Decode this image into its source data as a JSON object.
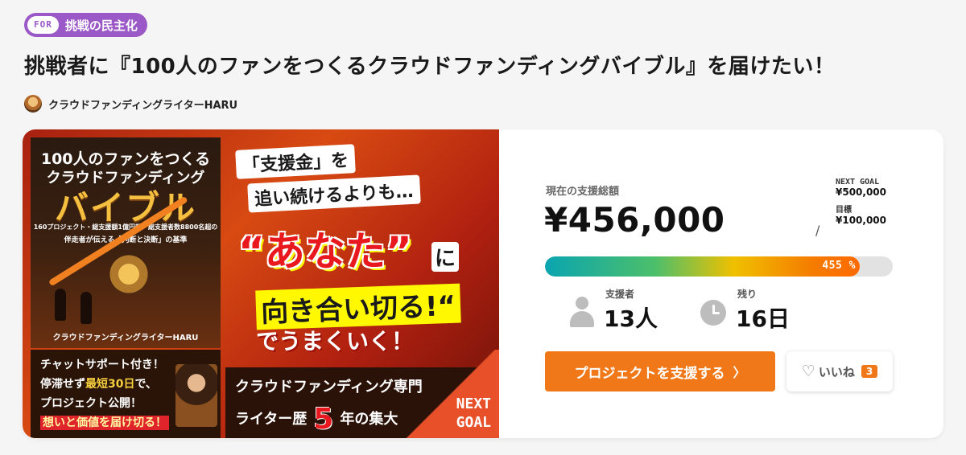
{
  "tag": {
    "prefix": "FOR",
    "label": "挑戦の民主化"
  },
  "title": "挑戦者に『100人のファンをつくるクラウドファンディングバイブル』を届けたい！",
  "author": {
    "name": "クラウドファンディングライターHARU"
  },
  "banner": {
    "book_line1": "100人のファンをつくる",
    "book_line2": "クラウドファンディング",
    "book_big": "バイブル",
    "book_sub1": "160プロジェクト・総支援額1億円超・総支援者数8800名超の",
    "book_sub2": "伴走者が伝える「判断と決断」の基準",
    "book_author": "クラウドファンディングライターHARU",
    "chat1": "チャットサポート付き！",
    "chat2a": "停滞せず",
    "chat2b": "最短30日",
    "chat2c": "で、",
    "chat3": "プロジェクト公開！",
    "chat4": "想いと価値を届け切る！",
    "headline1": "「支援金」を",
    "headline2": "追い続けるよりも…",
    "anata": "“あなた”",
    "ni": "に",
    "mukiai": "向き合い切る!“",
    "umaku": "でうまくいく！",
    "strip1": "クラウドファンディング専門",
    "strip2a": "ライター歴",
    "strip2_num": "5",
    "strip2b": "年の集大",
    "next1": "NEXT",
    "next2": "GOAL"
  },
  "stats": {
    "amount_label": "現在の支援総額",
    "amount": "¥456,000",
    "goal_slash": "/",
    "next_goal_caption": "NEXT GOAL",
    "next_goal_value": "¥500,000",
    "goal_caption": "目標",
    "goal_value": "¥100,000",
    "progress_percent": 455,
    "progress_label": "455 %",
    "supporters_label": "支援者",
    "supporters_value": "13人",
    "remaining_label": "残り",
    "remaining_value": "16日",
    "support_button": "プロジェクトを支援する",
    "support_chevron": "〉",
    "like_label": "いいね",
    "like_count": "3",
    "heart_icon": "heart-icon",
    "accent_color": "#f07818"
  }
}
